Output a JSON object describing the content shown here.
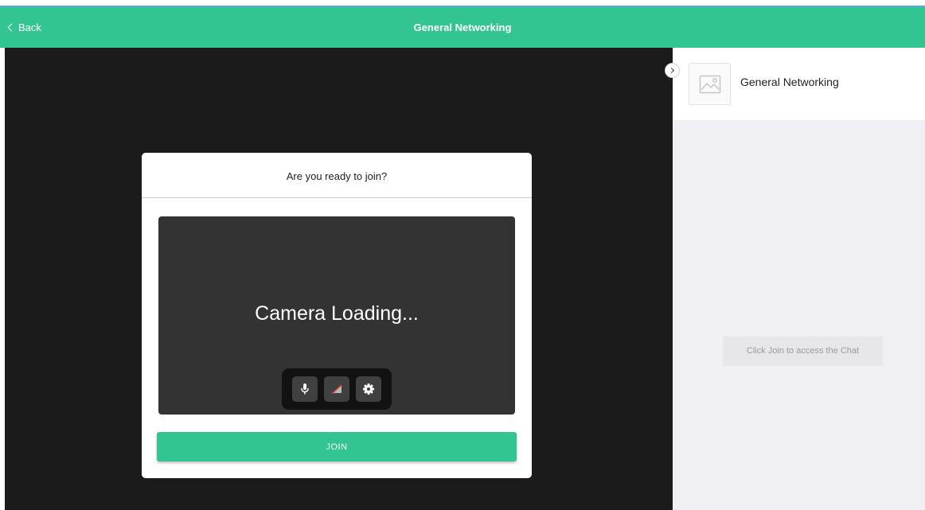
{
  "header": {
    "back_label": "Back",
    "title": "General Networking",
    "color": "#32c592"
  },
  "modal": {
    "title": "Are you ready to join?",
    "preview_text": "Camera Loading...",
    "controls": [
      {
        "name": "microphone-icon"
      },
      {
        "name": "camera-off-icon"
      },
      {
        "name": "gear-icon"
      }
    ],
    "join_label": "JOIN"
  },
  "sidebar": {
    "title": "General Networking",
    "thumbnail_icon": "image-placeholder-icon",
    "chat_note": "Click Join to access the Chat"
  }
}
